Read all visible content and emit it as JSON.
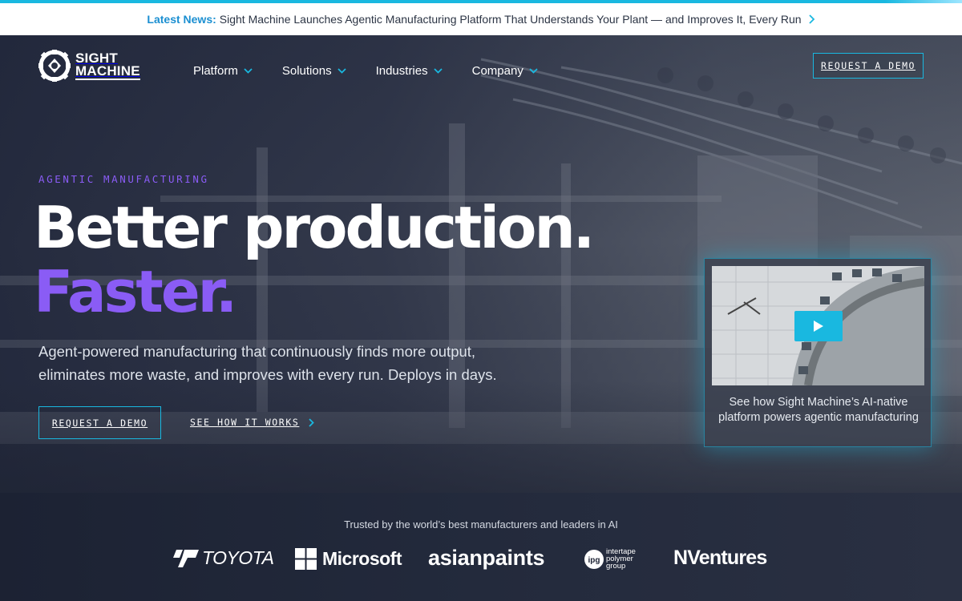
{
  "news": {
    "label": "Latest News:",
    "text": "Sight Machine Launches Agentic Manufacturing Platform That Understands Your Plant — and Improves It, Every Run",
    "chevron_icon": "chevron-right-icon"
  },
  "brand": {
    "line1": "SIGHT",
    "line2": "MACHINE",
    "logo_icon": "gear-aperture-icon",
    "accent_color": "#19b8e0",
    "purple_color": "#8a5cf5"
  },
  "nav": {
    "items": [
      {
        "label": "Platform"
      },
      {
        "label": "Solutions"
      },
      {
        "label": "Industries"
      },
      {
        "label": "Company"
      }
    ],
    "cta": "REQUEST A DEMO"
  },
  "hero": {
    "eyebrow": "AGENTIC MANUFACTURING",
    "headline_line1": "Better production.",
    "headline_line2": "Faster.",
    "subcopy": "Agent-powered manufacturing that continuously finds more output, eliminates more waste, and improves with every run. Deploys in days.",
    "primary_cta": "REQUEST A DEMO",
    "secondary_cta": "SEE HOW IT WORKS"
  },
  "video": {
    "caption": "See how Sight Machine’s AI-native platform powers agentic manufacturing",
    "play_icon": "play-icon"
  },
  "trusted": {
    "text": "Trusted by the world’s best manufacturers and leaders in AI",
    "logos": [
      {
        "name": "TOYOTA"
      },
      {
        "name": "Microsoft"
      },
      {
        "name": "asianpaints"
      },
      {
        "name": "intertape polymer group",
        "badge": "ipg"
      },
      {
        "name": "NVentures"
      }
    ]
  }
}
